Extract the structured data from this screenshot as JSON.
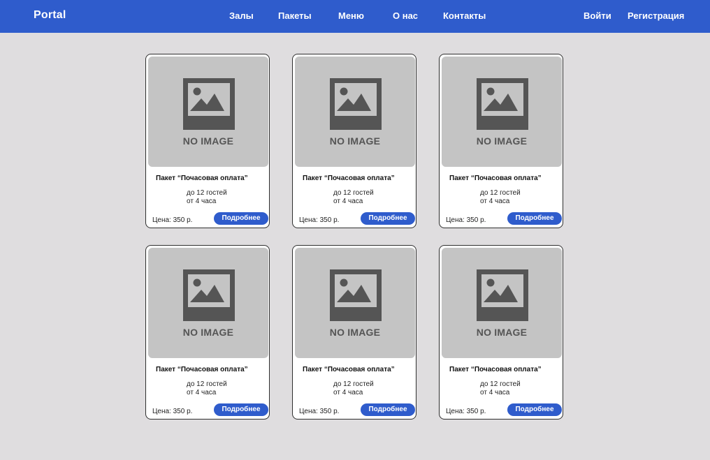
{
  "header": {
    "logo": "Portal",
    "nav": [
      "Залы",
      "Пакеты",
      "Меню",
      "О нас",
      "Контакты"
    ],
    "login": "Войти",
    "register": "Регистрация"
  },
  "cards": [
    {
      "image_label": "NO IMAGE",
      "title": "Пакет “Почасовая оплата”",
      "details": [
        "до 12 гостей",
        "от 4 часа"
      ],
      "price": "Цена: 350 р.",
      "button": "Подробнее"
    },
    {
      "image_label": "NO IMAGE",
      "title": "Пакет “Почасовая оплата”",
      "details": [
        "до 12 гостей",
        "от 4 часа"
      ],
      "price": "Цена: 350 р.",
      "button": "Подробнее"
    },
    {
      "image_label": "NO IMAGE",
      "title": "Пакет “Почасовая оплата”",
      "details": [
        "до 12 гостей",
        "от 4 часа"
      ],
      "price": "Цена: 350 р.",
      "button": "Подробнее"
    },
    {
      "image_label": "NO IMAGE",
      "title": "Пакет “Почасовая оплата”",
      "details": [
        "до 12 гостей",
        "от 4 часа"
      ],
      "price": "Цена: 350 р.",
      "button": "Подробнее"
    },
    {
      "image_label": "NO IMAGE",
      "title": "Пакет “Почасовая оплата”",
      "details": [
        "до 12 гостей",
        "от 4 часа"
      ],
      "price": "Цена: 350 р.",
      "button": "Подробнее"
    },
    {
      "image_label": "NO IMAGE",
      "title": "Пакет “Почасовая оплата”",
      "details": [
        "до 12 гостей",
        "от 4 часа"
      ],
      "price": "Цена: 350 р.",
      "button": "Подробнее"
    }
  ],
  "icons": {
    "placeholder": "image-placeholder-icon"
  },
  "colors": {
    "accent": "#2f5ccc",
    "background": "#dfdddf",
    "card": "#ffffff",
    "placeholder": "#c4c4c4",
    "icon": "#555555"
  }
}
